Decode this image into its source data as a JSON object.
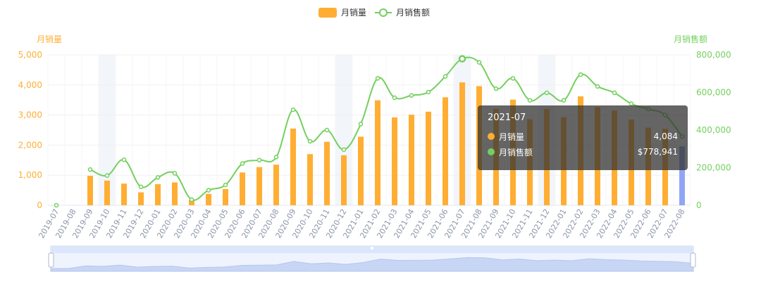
{
  "colors": {
    "bar": "#FFAE33",
    "bar_highlight": "#91A5F5",
    "line": "#74D05E",
    "axis_left": "#FFAE33",
    "axis_right": "#74D05E",
    "grid": "#f0f0f0",
    "band": "#F2F5FA",
    "tick_label": "#8C95A8"
  },
  "chart_data": {
    "type": "bar",
    "legend": {
      "position": "top-center",
      "items": [
        "月销量",
        "月销售额"
      ]
    },
    "x": [
      "2019-07",
      "2019-08",
      "2019-09",
      "2019-10",
      "2019-11",
      "2019-12",
      "2020-01",
      "2020-02",
      "2020-03",
      "2020-04",
      "2020-05",
      "2020-06",
      "2020-07",
      "2020-08",
      "2020-09",
      "2020-10",
      "2020-11",
      "2020-12",
      "2021-01",
      "2021-02",
      "2021-03",
      "2021-04",
      "2021-05",
      "2021-06",
      "2021-07",
      "2021-08",
      "2021-09",
      "2021-10",
      "2021-11",
      "2021-12",
      "2022-01",
      "2022-02",
      "2022-03",
      "2022-04",
      "2022-05",
      "2022-06",
      "2022-07",
      "2022-08"
    ],
    "series": [
      {
        "name": "月销量",
        "type": "bar",
        "axis": "left",
        "values": [
          0,
          0,
          980,
          820,
          720,
          430,
          700,
          760,
          180,
          380,
          540,
          1090,
          1270,
          1350,
          2550,
          1700,
          2110,
          1660,
          2280,
          3490,
          2920,
          3010,
          3110,
          3590,
          4084,
          3960,
          3200,
          3510,
          2860,
          3200,
          2930,
          3620,
          3260,
          3150,
          2850,
          2580,
          2540,
          1960
        ]
      },
      {
        "name": "月销售额",
        "type": "line",
        "axis": "right",
        "values": [
          0,
          null,
          190000,
          158000,
          242000,
          98000,
          148000,
          170000,
          30000,
          80000,
          108000,
          222000,
          240000,
          256000,
          508000,
          340000,
          400000,
          296000,
          432000,
          675000,
          572000,
          584000,
          602000,
          685000,
          778941,
          760000,
          620000,
          675000,
          558000,
          598000,
          558000,
          695000,
          632000,
          598000,
          540000,
          512000,
          480000,
          366000
        ]
      }
    ],
    "yaxis_left": {
      "name": "月销量",
      "min": 0,
      "max": 5000,
      "ticks": [
        0,
        1000,
        2000,
        3000,
        4000,
        5000
      ],
      "tick_labels": [
        "0",
        "1,000",
        "2,000",
        "3,000",
        "4,000",
        "5,000"
      ]
    },
    "yaxis_right": {
      "name": "月销售额",
      "min": 0,
      "max": 800000,
      "ticks": [
        0,
        200000,
        400000,
        600000,
        800000
      ],
      "tick_labels": [
        "0",
        "200,000",
        "400,000",
        "600,000",
        "800,000"
      ]
    },
    "highlighted_bar_index": 37,
    "shaded_categories": [
      3,
      17,
      24,
      29
    ],
    "grid": true
  },
  "tooltip": {
    "title": "2021-07",
    "rows": [
      {
        "name": "月销量",
        "value": "4,084",
        "color": "#FFAE33"
      },
      {
        "name": "月销售额",
        "value": "$778,941",
        "color": "#74D05E"
      }
    ]
  },
  "datazoom": {
    "start": 0,
    "end": 1
  }
}
